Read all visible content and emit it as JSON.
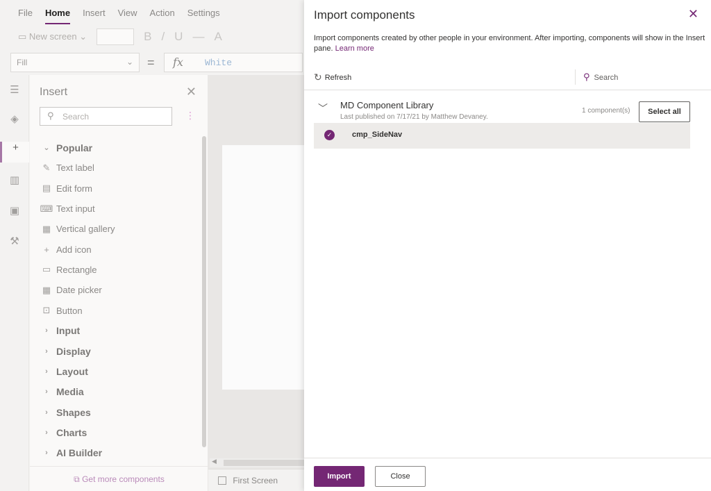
{
  "menubar": {
    "items": [
      {
        "label": "File"
      },
      {
        "label": "Home"
      },
      {
        "label": "Insert"
      },
      {
        "label": "View"
      },
      {
        "label": "Action"
      },
      {
        "label": "Settings"
      }
    ]
  },
  "ribbon": {
    "new_screen_label": "New screen",
    "bold_glyph": "B",
    "italic_glyph": "/",
    "underline_glyph": "U",
    "strike_glyph": "—",
    "font_glyph": "A"
  },
  "formula": {
    "property": "Fill",
    "fx_label": "fx",
    "value": "White"
  },
  "insert_pane": {
    "title": "Insert",
    "search_placeholder": "Search",
    "items": [
      {
        "label": "Popular",
        "icon": "chevron-down-icon",
        "group": true
      },
      {
        "label": "Text label",
        "icon": "text-label-icon"
      },
      {
        "label": "Edit form",
        "icon": "edit-form-icon"
      },
      {
        "label": "Text input",
        "icon": "text-input-icon"
      },
      {
        "label": "Vertical gallery",
        "icon": "gallery-icon"
      },
      {
        "label": "Add icon",
        "icon": "plus-icon"
      },
      {
        "label": "Rectangle",
        "icon": "rectangle-icon"
      },
      {
        "label": "Date picker",
        "icon": "calendar-icon"
      },
      {
        "label": "Button",
        "icon": "button-icon"
      },
      {
        "label": "Input",
        "icon": "chevron-right-icon",
        "group": true
      },
      {
        "label": "Display",
        "icon": "chevron-right-icon",
        "group": true
      },
      {
        "label": "Layout",
        "icon": "chevron-right-icon",
        "group": true
      },
      {
        "label": "Media",
        "icon": "chevron-right-icon",
        "group": true
      },
      {
        "label": "Shapes",
        "icon": "chevron-right-icon",
        "group": true
      },
      {
        "label": "Charts",
        "icon": "chevron-right-icon",
        "group": true
      },
      {
        "label": "AI Builder",
        "icon": "chevron-right-icon",
        "group": true
      }
    ],
    "get_more": "Get more components"
  },
  "canvas": {
    "screen_tab": "First Screen"
  },
  "import_panel": {
    "title": "Import components",
    "description": "Import components created by other people in your environment. After importing, components will show in the Insert pane.",
    "learn_more": "Learn more",
    "refresh_label": "Refresh",
    "search_label": "Search",
    "library": {
      "name": "MD Component Library",
      "subtitle": "Last published on 7/17/21 by Matthew Devaney.",
      "count": "1 component(s)",
      "select_all": "Select all",
      "components": [
        {
          "name": "cmp_SideNav",
          "selected": true
        }
      ]
    },
    "import_button": "Import",
    "close_button": "Close"
  },
  "colors": {
    "accent": "#742774",
    "panel_bg": "#ffffff",
    "selected_row": "#edebe9"
  }
}
